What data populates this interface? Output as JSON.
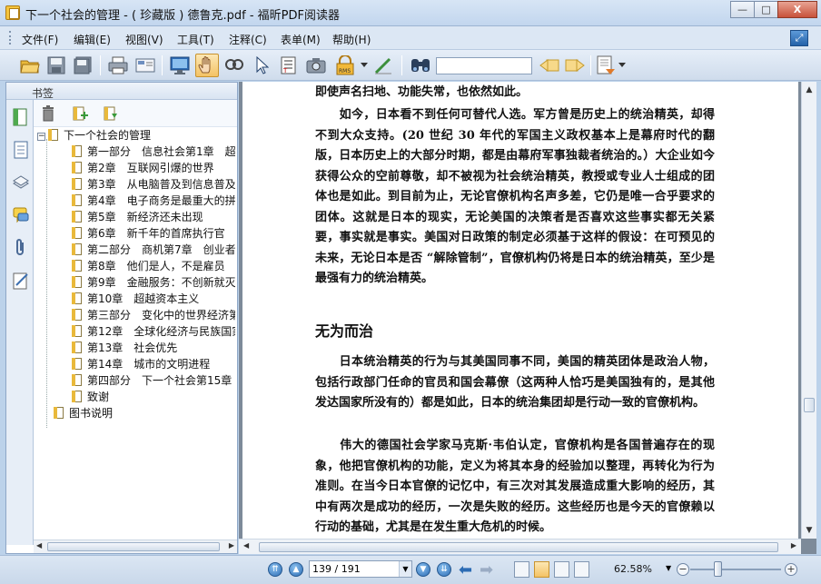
{
  "window": {
    "title": "下一个社会的管理 - ( 珍藏版 ) 德鲁克.pdf - 福昕PDF阅读器",
    "minimize": "—",
    "maximize": "□",
    "close": "X"
  },
  "menu": {
    "items": [
      "文件(F)",
      "编辑(E)",
      "视图(V)",
      "工具(T)",
      "注释(C)",
      "表单(M)",
      "帮助(H)"
    ]
  },
  "toolbar": {
    "buttons": [
      "open-icon",
      "save-icon",
      "save-as-icon",
      "print-icon",
      "email-icon",
      "fullscreen-icon",
      "hand-tool-icon",
      "zoom-tool-icon",
      "select-tool-icon",
      "text-select-icon",
      "snapshot-icon",
      "rms-lock-icon",
      "sign-icon",
      "find-icon",
      "search-prev-icon",
      "search-next-icon",
      "comment-list-icon"
    ],
    "search_value": ""
  },
  "bookmarks": {
    "header": "书签",
    "root": "下一个社会的管理",
    "items": [
      "第一部分　信息社会第1章　超",
      "第2章　互联网引爆的世界",
      "第3章　从电脑普及到信息普及",
      "第4章　电子商务是最重大的拼",
      "第5章　新经济还未出现",
      "第6章　新千年的首席执行官",
      "第二部分　商机第7章　创业者",
      "第8章　他们是人，不是雇员",
      "第9章　金融服务：不创新就灭",
      "第10章　超越资本主义",
      "第三部分　变化中的世界经济第",
      "第12章　全球化经济与民族国家",
      "第13章　社会优先",
      "第14章　城市的文明进程",
      "第四部分　下一个社会第15章",
      "致谢"
    ],
    "last": "图书说明"
  },
  "document": {
    "paragraphs": [
      "即使声名扫地、功能失常，也依然如此。",
      "　　如今，日本看不到任何可替代人选。军方曾是历史上的统治精英，却得不到大众支持。(20 世纪 30 年代的军国主义政权基本上是幕府时代的翻版，日本历史上的大部分时期，都是由幕府军事独裁者统治的。）大企业如今获得公众的空前尊敬，却不被视为社会统治精英，教授或专业人士组成的团体也是如此。到目前为止，无论官僚机构名声多差，它仍是唯一合乎要求的团体。这就是日本的现实，无论美国的决策者是否喜欢这些事实都无关紧要，事实就是事实。美国对日政策的制定必须基于这样的假设：在可预见的未来，无论日本是否 “解除管制”，官僚机构仍将是日本的统治精英，至少是最强有力的统治精英。",
      "　　日本统治精英的行为与其美国同事不同，美国的精英团体是政治人物，包括行政部门任命的官员和国会幕僚（这两种人恰巧是美国独有的，是其他发达国家所没有的）都是如此，日本的统治集团却是行动一致的官僚机构。",
      "　　伟大的德国社会学家马克斯·韦伯认定，官僚机构是各国普遍存在的现象，他把官僚机构的功能，定义为将其本身的经验加以整理，再转化为行为准则。在当今日本官僚的记忆中，有三次对其发展造成重大影响的经历，其中有两次是成功的经历，一次是失败的经历。这些经历也是今天的官僚赖以行动的基础，尤其是在发生重大危机的时候。"
    ],
    "heading": "无为而治"
  },
  "status": {
    "page_display": "139 / 191",
    "zoom": "62.58%"
  }
}
